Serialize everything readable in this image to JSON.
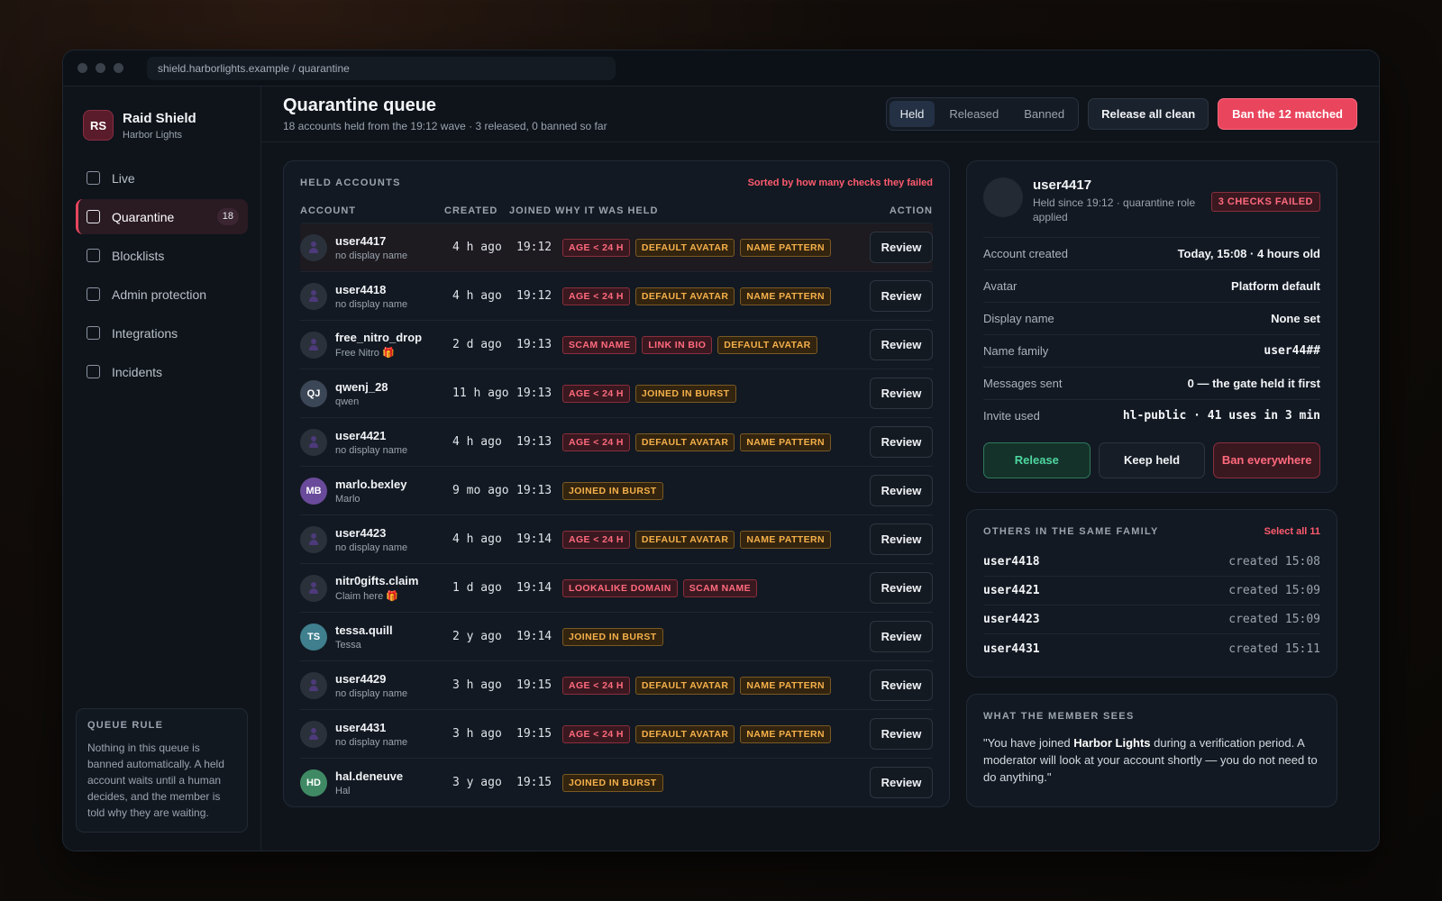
{
  "browser": {
    "url": "shield.harborlights.example / quarantine"
  },
  "brand": {
    "logo": "RS",
    "name": "Raid Shield",
    "server": "Harbor Lights"
  },
  "nav": [
    {
      "label": "Live",
      "icon": "square-icon"
    },
    {
      "label": "Quarantine",
      "icon": "square-icon",
      "badge": "18",
      "active": true
    },
    {
      "label": "Blocklists",
      "icon": "square-icon"
    },
    {
      "label": "Admin protection",
      "icon": "square-icon"
    },
    {
      "label": "Integrations",
      "icon": "square-icon"
    },
    {
      "label": "Incidents",
      "icon": "square-icon"
    }
  ],
  "queue_rule": {
    "title": "QUEUE RULE",
    "text": "Nothing in this queue is banned automatically. A held account waits until a human decides, and the member is told why they are waiting."
  },
  "header": {
    "title": "Quarantine queue",
    "subtitle": "18 accounts held from the 19:12 wave · 3 released, 0 banned so far",
    "tabs": [
      "Held",
      "Released",
      "Banned"
    ],
    "active_tab": "Held",
    "release_all": "Release all clean",
    "ban_matched": "Ban the 12 matched"
  },
  "held": {
    "title": "HELD ACCOUNTS",
    "sort_note": "Sorted by how many checks they failed",
    "columns": [
      "ACCOUNT",
      "CREATED",
      "JOINED",
      "WHY IT WAS HELD",
      "ACTION"
    ],
    "review_label": "Review",
    "rows": [
      {
        "name": "user4417",
        "display": "no display name",
        "created": "4 h ago",
        "joined": "19:12",
        "avatar": "",
        "avatar_color": "",
        "tags": [
          [
            "AGE < 24 H",
            "red"
          ],
          [
            "DEFAULT AVATAR",
            "amber"
          ],
          [
            "NAME PATTERN",
            "amber"
          ]
        ]
      },
      {
        "name": "user4418",
        "display": "no display name",
        "created": "4 h ago",
        "joined": "19:12",
        "avatar": "",
        "avatar_color": "",
        "tags": [
          [
            "AGE < 24 H",
            "red"
          ],
          [
            "DEFAULT AVATAR",
            "amber"
          ],
          [
            "NAME PATTERN",
            "amber"
          ]
        ]
      },
      {
        "name": "free_nitro_drop",
        "display": "Free Nitro 🎁",
        "created": "2 d ago",
        "joined": "19:13",
        "avatar": "",
        "avatar_color": "",
        "tags": [
          [
            "SCAM NAME",
            "red"
          ],
          [
            "LINK IN BIO",
            "red"
          ],
          [
            "DEFAULT AVATAR",
            "amber"
          ]
        ]
      },
      {
        "name": "qwenj_28",
        "display": "qwen",
        "created": "11 h ago",
        "joined": "19:13",
        "avatar": "QJ",
        "avatar_color": "#3b4656",
        "tags": [
          [
            "AGE < 24 H",
            "red"
          ],
          [
            "JOINED IN BURST",
            "amber"
          ]
        ]
      },
      {
        "name": "user4421",
        "display": "no display name",
        "created": "4 h ago",
        "joined": "19:13",
        "avatar": "",
        "avatar_color": "",
        "tags": [
          [
            "AGE < 24 H",
            "red"
          ],
          [
            "DEFAULT AVATAR",
            "amber"
          ],
          [
            "NAME PATTERN",
            "amber"
          ]
        ]
      },
      {
        "name": "marlo.bexley",
        "display": "Marlo",
        "created": "9 mo ago",
        "joined": "19:13",
        "avatar": "MB",
        "avatar_color": "#6a4a9a",
        "tags": [
          [
            "JOINED IN BURST",
            "amber"
          ]
        ]
      },
      {
        "name": "user4423",
        "display": "no display name",
        "created": "4 h ago",
        "joined": "19:14",
        "avatar": "",
        "avatar_color": "",
        "tags": [
          [
            "AGE < 24 H",
            "red"
          ],
          [
            "DEFAULT AVATAR",
            "amber"
          ],
          [
            "NAME PATTERN",
            "amber"
          ]
        ]
      },
      {
        "name": "nitr0gifts.claim",
        "display": "Claim here 🎁",
        "created": "1 d ago",
        "joined": "19:14",
        "avatar": "",
        "avatar_color": "",
        "tags": [
          [
            "LOOKALIKE DOMAIN",
            "red"
          ],
          [
            "SCAM NAME",
            "red"
          ]
        ]
      },
      {
        "name": "tessa.quill",
        "display": "Tessa",
        "created": "2 y ago",
        "joined": "19:14",
        "avatar": "TS",
        "avatar_color": "#3f7f8e",
        "tags": [
          [
            "JOINED IN BURST",
            "amber"
          ]
        ]
      },
      {
        "name": "user4429",
        "display": "no display name",
        "created": "3 h ago",
        "joined": "19:15",
        "avatar": "",
        "avatar_color": "",
        "tags": [
          [
            "AGE < 24 H",
            "red"
          ],
          [
            "DEFAULT AVATAR",
            "amber"
          ],
          [
            "NAME PATTERN",
            "amber"
          ]
        ]
      },
      {
        "name": "user4431",
        "display": "no display name",
        "created": "3 h ago",
        "joined": "19:15",
        "avatar": "",
        "avatar_color": "",
        "tags": [
          [
            "AGE < 24 H",
            "red"
          ],
          [
            "DEFAULT AVATAR",
            "amber"
          ],
          [
            "NAME PATTERN",
            "amber"
          ]
        ]
      },
      {
        "name": "hal.deneuve",
        "display": "Hal",
        "created": "3 y ago",
        "joined": "19:15",
        "avatar": "HD",
        "avatar_color": "#3f8a64",
        "tags": [
          [
            "JOINED IN BURST",
            "amber"
          ]
        ]
      }
    ]
  },
  "detail": {
    "name": "user4417",
    "sub": "Held since 19:12 · quarantine role applied",
    "badge": "3 CHECKS FAILED",
    "fields": [
      {
        "k": "Account created",
        "v": "Today, 15:08 · 4 hours old",
        "mono": false
      },
      {
        "k": "Avatar",
        "v": "Platform default",
        "mono": false
      },
      {
        "k": "Display name",
        "v": "None set",
        "mono": false
      },
      {
        "k": "Name family",
        "v": "user44##",
        "mono": true
      },
      {
        "k": "Messages sent",
        "v": "0 — the gate held it first",
        "mono": false
      },
      {
        "k": "Invite used",
        "v": "hl-public · 41 uses in 3 min",
        "mono": true
      }
    ],
    "actions": {
      "release": "Release",
      "keep": "Keep held",
      "ban": "Ban everywhere"
    }
  },
  "family": {
    "title": "OTHERS IN THE SAME FAMILY",
    "select_all": "Select all 11",
    "items": [
      {
        "user": "user4418",
        "created": "created 15:08"
      },
      {
        "user": "user4421",
        "created": "created 15:09"
      },
      {
        "user": "user4423",
        "created": "created 15:09"
      },
      {
        "user": "user4431",
        "created": "created 15:11"
      }
    ]
  },
  "member_sees": {
    "title": "WHAT THE MEMBER SEES",
    "before": "\"You have joined ",
    "server": "Harbor Lights",
    "after": " during a verification period. A moderator will look at your account shortly — you do not need to do anything.\""
  },
  "colors": {
    "accent_red": "#e9455d",
    "warn_amber": "#f5b04a",
    "ok_green": "#4fd6a0"
  }
}
